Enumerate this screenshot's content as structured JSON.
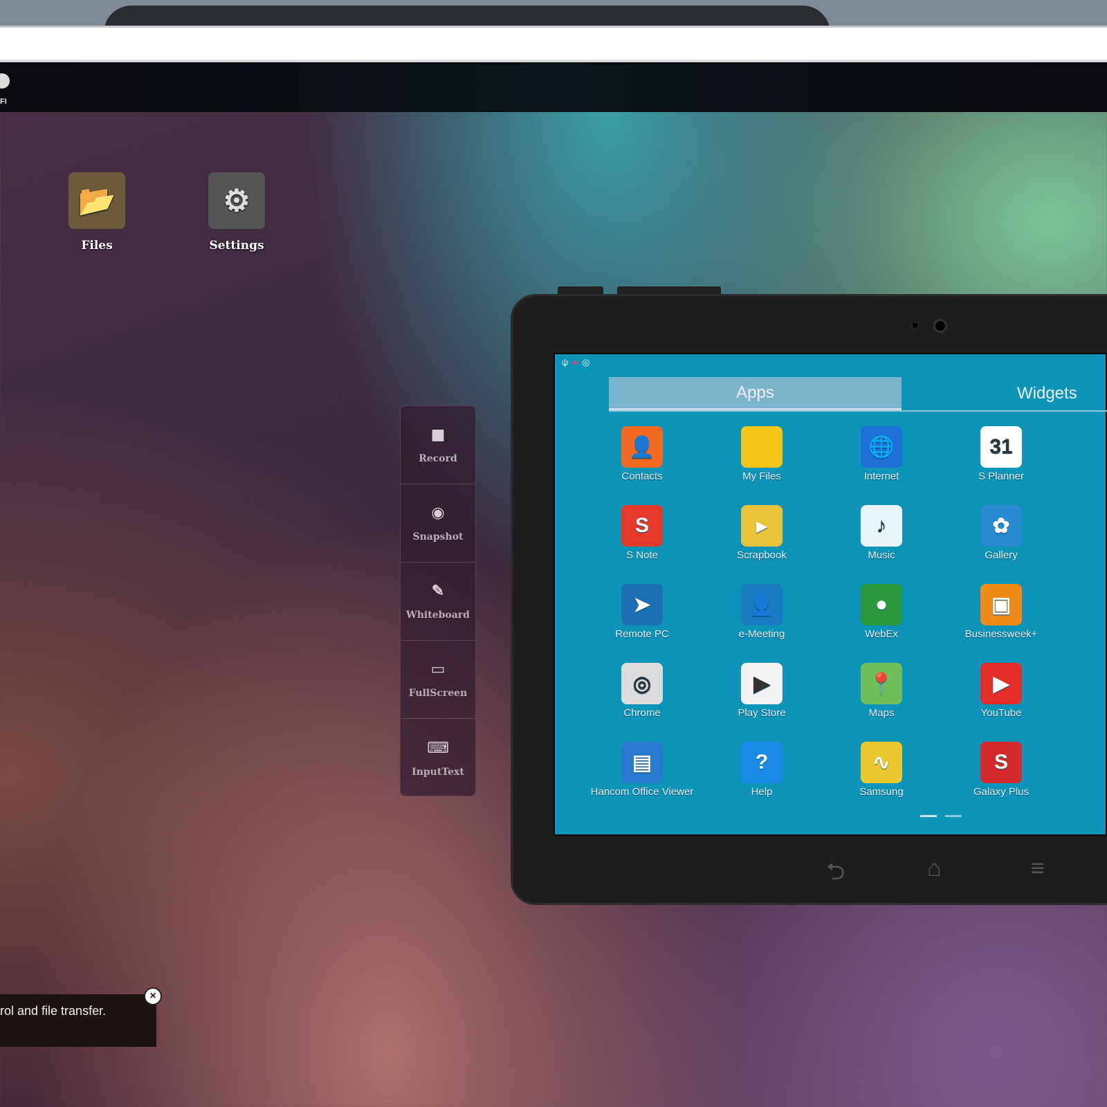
{
  "dock": {
    "wifi_label": "FI"
  },
  "desktop": [
    {
      "label": "Files",
      "icon": "folder-icon",
      "color": "#6b5a3c",
      "glyph": "📂"
    },
    {
      "label": "Settings",
      "icon": "gear-icon",
      "color": "#555555",
      "glyph": "⚙"
    }
  ],
  "toolbar": [
    {
      "label": "Record",
      "icon": "video-camera-icon",
      "glyph": "■"
    },
    {
      "label": "Snapshot",
      "icon": "camera-icon",
      "glyph": "◉"
    },
    {
      "label": "Whiteboard",
      "icon": "pencil-icon",
      "glyph": "✎"
    },
    {
      "label": "FullScreen",
      "icon": "monitor-icon",
      "glyph": "▭"
    },
    {
      "label": "InputText",
      "icon": "keyboard-icon",
      "glyph": "⌨"
    }
  ],
  "tablet": {
    "status_icons": [
      "usb-icon",
      "notification-icon",
      "compass-icon"
    ],
    "tabs": {
      "apps": "Apps",
      "widgets": "Widgets"
    },
    "apps": [
      {
        "label": "Contacts",
        "color": "#f26a21",
        "glyph": "👤"
      },
      {
        "label": "My Files",
        "color": "#f5c518",
        "glyph": ""
      },
      {
        "label": "Internet",
        "color": "#1e6fd6",
        "glyph": "🌐"
      },
      {
        "label": "S Planner",
        "color": "#ffffff",
        "glyph": "31"
      },
      {
        "label": "S Note",
        "color": "#e53a2a",
        "glyph": "S"
      },
      {
        "label": "Scrapbook",
        "color": "#e9c33a",
        "glyph": "▸"
      },
      {
        "label": "Music",
        "color": "#e8f4fa",
        "glyph": "♪"
      },
      {
        "label": "Gallery",
        "color": "#2a8ad0",
        "glyph": "✿"
      },
      {
        "label": "Remote PC",
        "color": "#1c6fb0",
        "glyph": "➤"
      },
      {
        "label": "e-Meeting",
        "color": "#1a7ac0",
        "glyph": "👤"
      },
      {
        "label": "WebEx",
        "color": "#2a9a3a",
        "glyph": "●"
      },
      {
        "label": "Businessweek+",
        "color": "#f08a1a",
        "glyph": "▣"
      },
      {
        "label": "Chrome",
        "color": "#dddddd",
        "glyph": "◎"
      },
      {
        "label": "Play Store",
        "color": "#f2f2f2",
        "glyph": "▶"
      },
      {
        "label": "Maps",
        "color": "#6fbf5a",
        "glyph": "📍"
      },
      {
        "label": "YouTube",
        "color": "#e52d27",
        "glyph": "▶"
      },
      {
        "label": "Hancom Office Viewer",
        "color": "#2a7ad0",
        "glyph": "▤"
      },
      {
        "label": "Help",
        "color": "#1a8ae6",
        "glyph": "?"
      },
      {
        "label": "Samsung",
        "color": "#e8c82a",
        "glyph": "∿"
      },
      {
        "label": "Galaxy Plus",
        "color": "#d62a2a",
        "glyph": "S"
      }
    ],
    "nav": {
      "back": "⮌",
      "home": "⌂",
      "menu": "≡"
    }
  },
  "toast": {
    "text": "rol and file transfer.",
    "close": "×"
  }
}
